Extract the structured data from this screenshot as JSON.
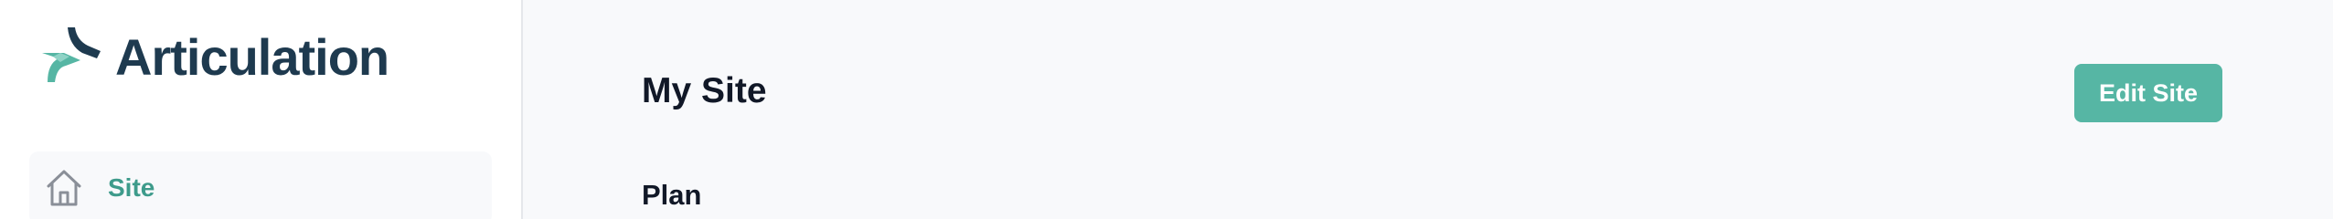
{
  "brand": {
    "name": "Articulation",
    "colors": {
      "primary": "#1e3a4f",
      "accent": "#56b6a4"
    }
  },
  "sidebar": {
    "items": [
      {
        "label": "Site",
        "icon": "home-icon",
        "active": true
      }
    ]
  },
  "main": {
    "title": "My Site",
    "edit_button_label": "Edit Site",
    "section_heading": "Plan"
  }
}
